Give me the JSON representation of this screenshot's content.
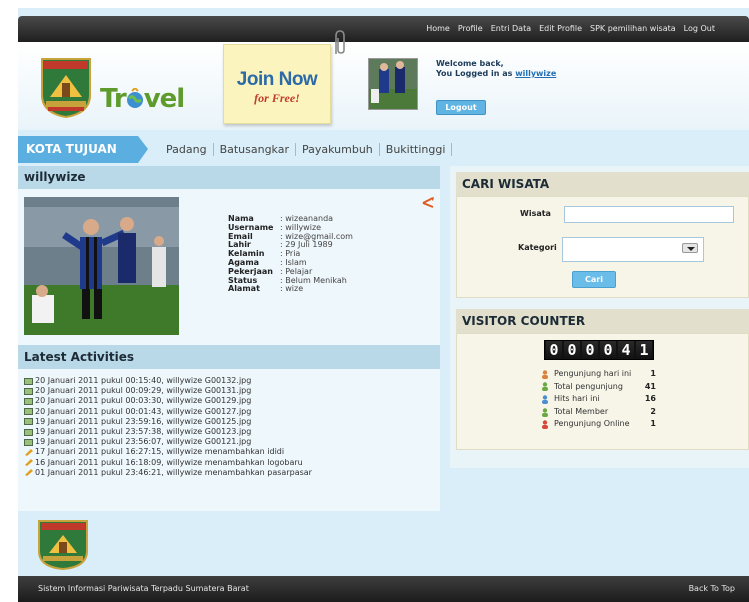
{
  "nav": {
    "items": [
      "Home",
      "Profile",
      "Entri Data",
      "Edit Profile",
      "SPK pemilihan wisata",
      "Log Out"
    ]
  },
  "header": {
    "crest_text": "SUMATERA BARAT",
    "logo_left": "Tr",
    "logo_right": "vel",
    "join_now": "Join Now",
    "for_free": "for Free!",
    "welcome_line": "Welcome back,",
    "logged_in_as": "You Logged in as",
    "username": "willywize",
    "logout_label": "Logout"
  },
  "category": {
    "title": "KOTA TUJUAN",
    "links": [
      "Padang",
      "Batusangkar",
      "Payakumbuh",
      "Bukittinggi"
    ]
  },
  "profile": {
    "title": "willywize",
    "fields": [
      {
        "label": "Nama",
        "value": ": wizeananda"
      },
      {
        "label": "Username",
        "value": ": willywize"
      },
      {
        "label": "Email",
        "value": ": wize@gmail.com"
      },
      {
        "label": "Lahir",
        "value": ": 29 Juli 1989"
      },
      {
        "label": "Kelamin",
        "value": ": Pria"
      },
      {
        "label": "Agama",
        "value": ": Islam"
      },
      {
        "label": "Pekerjaan",
        "value": ": Pelajar"
      },
      {
        "label": "Status",
        "value": ": Belum Menikah"
      },
      {
        "label": "Alamat",
        "value": ": wize"
      }
    ]
  },
  "activities": {
    "title": "Latest Activities",
    "items": [
      {
        "type": "image",
        "text": "20 Januari 2011 pukul 00:15:40, willywize G00132.jpg"
      },
      {
        "type": "image",
        "text": "20 Januari 2011 pukul 00:09:29, willywize G00131.jpg"
      },
      {
        "type": "image",
        "text": "20 Januari 2011 pukul 00:03:30, willywize G00129.jpg"
      },
      {
        "type": "image",
        "text": "20 Januari 2011 pukul 00:01:43, willywize G00127.jpg"
      },
      {
        "type": "image",
        "text": "19 Januari 2011 pukul 23:59:16, willywize G00125.jpg"
      },
      {
        "type": "image",
        "text": "19 Januari 2011 pukul 23:57:38, willywize G00123.jpg"
      },
      {
        "type": "image",
        "text": "19 Januari 2011 pukul 23:56:07, willywize G00121.jpg"
      },
      {
        "type": "edit",
        "text": "17 Januari 2011 pukul 16:27:15, willywize menambahkan ididi"
      },
      {
        "type": "edit",
        "text": "16 Januari 2011 pukul 16:18:09, willywize menambahkan logobaru"
      },
      {
        "type": "edit",
        "text": "01 Januari 2011 pukul 23:46:21, willywize menambahkan pasarpasar"
      }
    ]
  },
  "search": {
    "title": "CARI WISATA",
    "wisata_label": "Wisata",
    "wisata_value": "",
    "kategori_label": "Kategori",
    "kategori_value": "",
    "button_label": "Cari"
  },
  "visitor": {
    "title": "VISITOR COUNTER",
    "digits": [
      "0",
      "0",
      "0",
      "0",
      "4",
      "1"
    ],
    "stats": [
      {
        "label": "Pengunjung hari ini",
        "value": "1",
        "color": "#d9823b"
      },
      {
        "label": "Total pengunjung",
        "value": "41",
        "color": "#6aa846"
      },
      {
        "label": "Hits hari ini",
        "value": "16",
        "color": "#4a8fd0"
      },
      {
        "label": "Total Member",
        "value": "2",
        "color": "#6aa846"
      },
      {
        "label": "Pengunjung Online",
        "value": "1",
        "color": "#d44a3a"
      }
    ]
  },
  "footer": {
    "left_text": "Sistem Informasi Pariwisata Terpadu Sumatera Barat",
    "right_text": "Back To Top"
  }
}
